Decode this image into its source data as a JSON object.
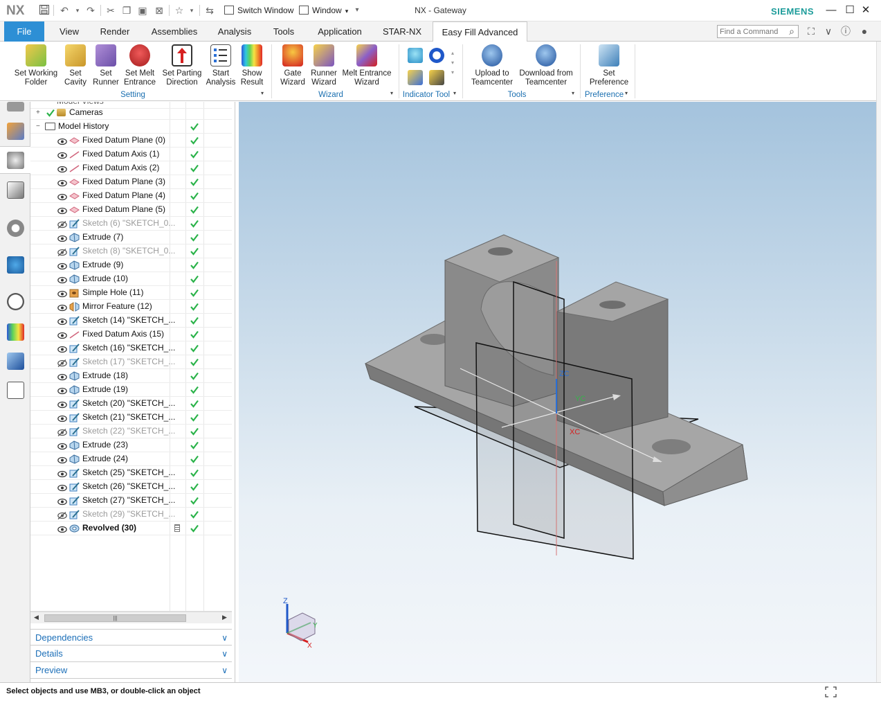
{
  "app": {
    "logo": "NX",
    "title": "NX - Gateway",
    "brand": "SIEMENS",
    "quick_access": {
      "switch_window": "Switch Window",
      "window_menu": "Window"
    }
  },
  "ribbon_tabs": [
    {
      "label": "File"
    },
    {
      "label": "View"
    },
    {
      "label": "Render"
    },
    {
      "label": "Assemblies"
    },
    {
      "label": "Analysis"
    },
    {
      "label": "Tools"
    },
    {
      "label": "Application"
    },
    {
      "label": "STAR-NX"
    },
    {
      "label": "Easy Fill Advanced"
    }
  ],
  "command_finder": {
    "placeholder": "Find a Command"
  },
  "ribbon": {
    "setting_group": {
      "label": "Setting",
      "buttons": [
        {
          "label": "Set Working Folder",
          "icon": "set-working-folder-icon"
        },
        {
          "label": "Set Cavity",
          "icon": "set-cavity-icon"
        },
        {
          "label": "Set Runner",
          "icon": "set-runner-icon"
        },
        {
          "label": "Set Melt Entrance",
          "icon": "set-melt-entrance-icon"
        },
        {
          "label": "Set Parting Direction",
          "icon": "set-parting-direction-icon"
        },
        {
          "label": "Start Analysis",
          "icon": "start-analysis-icon"
        },
        {
          "label": "Show Result",
          "icon": "show-result-icon"
        }
      ]
    },
    "wizard_group": {
      "label": "Wizard",
      "buttons": [
        {
          "label": "Gate Wizard",
          "icon": "gate-wizard-icon"
        },
        {
          "label": "Runner Wizard",
          "icon": "runner-wizard-icon"
        },
        {
          "label": "Melt Entrance Wizard",
          "icon": "melt-entrance-wizard-icon"
        }
      ]
    },
    "indicator_group": {
      "label": "Indicator Tool"
    },
    "tools_group": {
      "label": "Tools",
      "buttons": [
        {
          "label": "Upload to Teamcenter",
          "icon": "upload-teamcenter-icon"
        },
        {
          "label": "Download from Teamcenter",
          "icon": "download-teamcenter-icon"
        }
      ]
    },
    "preference_group": {
      "label": "Preference",
      "buttons": [
        {
          "label": "Set Preference",
          "icon": "set-preference-icon"
        }
      ]
    }
  },
  "navigator": {
    "partial_top": "Model Views",
    "cameras": "Cameras",
    "model_history": "Model History",
    "features": [
      {
        "name": "Fixed Datum Plane (0)",
        "type": "datum-plane",
        "visible": true,
        "dim": false
      },
      {
        "name": "Fixed Datum Axis (1)",
        "type": "datum-axis",
        "visible": true,
        "dim": false
      },
      {
        "name": "Fixed Datum Axis (2)",
        "type": "datum-axis",
        "visible": true,
        "dim": false
      },
      {
        "name": "Fixed Datum Plane (3)",
        "type": "datum-plane",
        "visible": true,
        "dim": false
      },
      {
        "name": "Fixed Datum Plane (4)",
        "type": "datum-plane",
        "visible": true,
        "dim": false
      },
      {
        "name": "Fixed Datum Plane (5)",
        "type": "datum-plane",
        "visible": true,
        "dim": false
      },
      {
        "name": "Sketch (6) \"SKETCH_0...",
        "type": "sketch",
        "visible": false,
        "dim": true
      },
      {
        "name": "Extrude (7)",
        "type": "extrude",
        "visible": true,
        "dim": false
      },
      {
        "name": "Sketch (8) \"SKETCH_0...",
        "type": "sketch",
        "visible": false,
        "dim": true
      },
      {
        "name": "Extrude (9)",
        "type": "extrude",
        "visible": true,
        "dim": false
      },
      {
        "name": "Extrude (10)",
        "type": "extrude",
        "visible": true,
        "dim": false
      },
      {
        "name": "Simple Hole (11)",
        "type": "hole",
        "visible": true,
        "dim": false
      },
      {
        "name": "Mirror Feature (12)",
        "type": "mirror",
        "visible": true,
        "dim": false
      },
      {
        "name": "Sketch (14) \"SKETCH_...",
        "type": "sketch",
        "visible": true,
        "dim": false
      },
      {
        "name": "Fixed Datum Axis (15)",
        "type": "datum-axis",
        "visible": true,
        "dim": false
      },
      {
        "name": "Sketch (16) \"SKETCH_...",
        "type": "sketch",
        "visible": true,
        "dim": false
      },
      {
        "name": "Sketch (17) \"SKETCH_...",
        "type": "sketch",
        "visible": false,
        "dim": true
      },
      {
        "name": "Extrude (18)",
        "type": "extrude",
        "visible": true,
        "dim": false
      },
      {
        "name": "Extrude (19)",
        "type": "extrude",
        "visible": true,
        "dim": false
      },
      {
        "name": "Sketch (20) \"SKETCH_...",
        "type": "sketch",
        "visible": true,
        "dim": false
      },
      {
        "name": "Sketch (21) \"SKETCH_...",
        "type": "sketch",
        "visible": true,
        "dim": false
      },
      {
        "name": "Sketch (22) \"SKETCH_...",
        "type": "sketch",
        "visible": false,
        "dim": true
      },
      {
        "name": "Extrude (23)",
        "type": "extrude",
        "visible": true,
        "dim": false
      },
      {
        "name": "Extrude (24)",
        "type": "extrude",
        "visible": true,
        "dim": false
      },
      {
        "name": "Sketch (25) \"SKETCH_...",
        "type": "sketch",
        "visible": true,
        "dim": false
      },
      {
        "name": "Sketch (26) \"SKETCH_...",
        "type": "sketch",
        "visible": true,
        "dim": false
      },
      {
        "name": "Sketch (27) \"SKETCH_...",
        "type": "sketch",
        "visible": true,
        "dim": false
      },
      {
        "name": "Sketch (29) \"SKETCH_...",
        "type": "sketch",
        "visible": false,
        "dim": true
      },
      {
        "name": "Revolved (30)",
        "type": "revolve",
        "visible": true,
        "dim": false,
        "bold": true
      }
    ],
    "panels": [
      "Dependencies",
      "Details",
      "Preview"
    ]
  },
  "viewport": {
    "wcs_labels": {
      "z": "ZC",
      "y": "YC",
      "x": "XC"
    },
    "triad_labels": {
      "z": "Z",
      "y": "Y",
      "x": "X"
    }
  },
  "status": {
    "message": "Select objects and use MB3, or double-click an object"
  },
  "colors": {
    "file_tab": "#2d8fd5",
    "brand": "#1c9c9a",
    "group_label": "#1a6fb0",
    "check": "#2bb34a",
    "part_gray": "#8c8c8c"
  }
}
